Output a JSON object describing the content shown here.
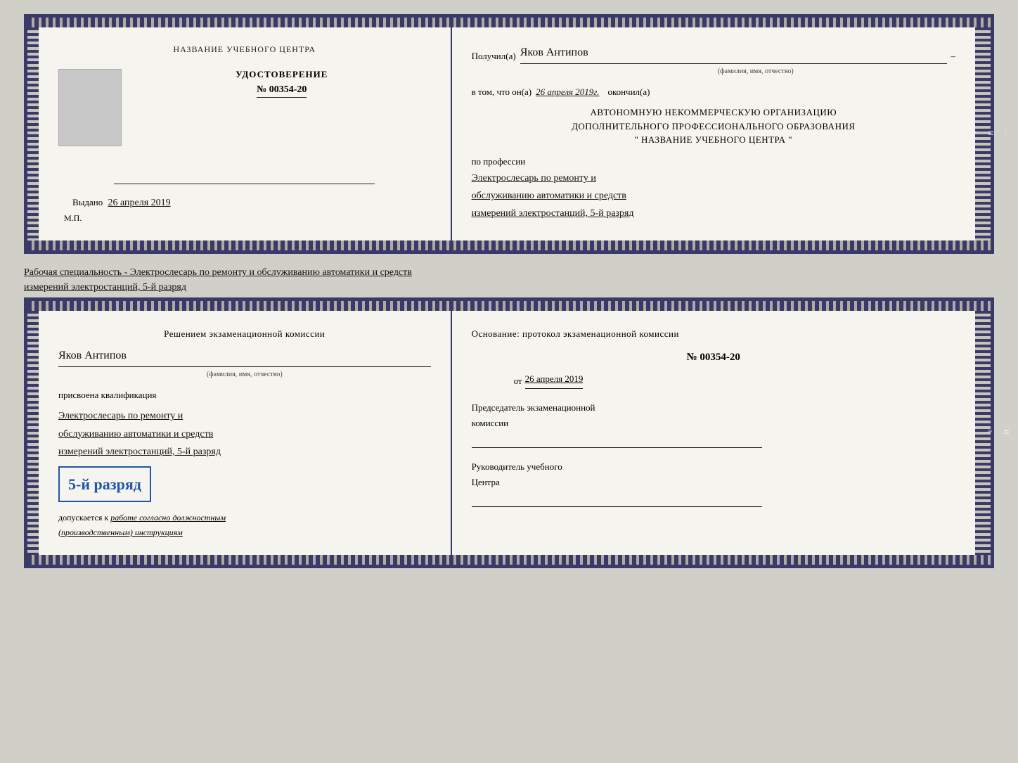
{
  "top_doc": {
    "left": {
      "header": "НАЗВАНИЕ УЧЕБНОГО ЦЕНТРА",
      "udost_title": "УДОСТОВЕРЕНИЕ",
      "udost_number": "№ 00354-20",
      "vydano_label": "Выдано",
      "vydano_date": "26 апреля 2019",
      "mp_label": "М.П."
    },
    "right": {
      "poluchil_label": "Получил(а)",
      "full_name": "Яков Антипов",
      "fio_sub": "(фамилия, имя, отчество)",
      "vtom_label": "в том, что он(а)",
      "date_value": "26 апреля 2019г.",
      "okonchill_label": "окончил(а)",
      "org_line1": "АВТОНОМНУЮ НЕКОММЕРЧЕСКУЮ ОРГАНИЗАЦИЮ",
      "org_line2": "ДОПОЛНИТЕЛЬНОГО ПРОФЕССИОНАЛЬНОГО ОБРАЗОВАНИЯ",
      "org_line3": "\"   НАЗВАНИЕ УЧЕБНОГО ЦЕНТРА   \"",
      "po_professii": "по профессии",
      "profession_line1": "Электрослесарь по ремонту и",
      "profession_line2": "обслуживанию автоматики и средств",
      "profession_line3": "измерений электростанций, 5-й разряд"
    }
  },
  "between_label": {
    "line1": "Рабочая специальность - Электрослесарь по ремонту и обслуживанию автоматики и средств",
    "line2": "измерений электростанций, 5-й разряд"
  },
  "bottom_doc": {
    "left": {
      "resheniem_label": "Решением экзаменационной комиссии",
      "full_name": "Яков Антипов",
      "fio_sub": "(фамилия, имя, отчество)",
      "prisvoena_label": "присвоена квалификация",
      "prof_line1": "Электрослесарь по ремонту и",
      "prof_line2": "обслуживанию автоматики и средств",
      "prof_line3": "измерений электростанций, 5-й разряд",
      "rank_badge": "5-й разряд",
      "dopuskaetsya_label": "допускается к",
      "rabota_text": "работе согласно должностным",
      "instruktsii_text": "(производственным) инструкциям"
    },
    "right": {
      "osnovanie_label": "Основание: протокол экзаменационной комиссии",
      "number_label": "№ 00354-20",
      "ot_label": "от",
      "ot_date": "26 апреля 2019",
      "predsedatel_label": "Председатель экзаменационной",
      "komissii_label": "комиссии",
      "rukovoditel_label": "Руководитель учебного",
      "tsentra_label": "Центра"
    }
  },
  "side_labels": {
    "items": [
      "И",
      "а",
      "←",
      "–",
      "–",
      "–",
      "–",
      "–"
    ]
  }
}
